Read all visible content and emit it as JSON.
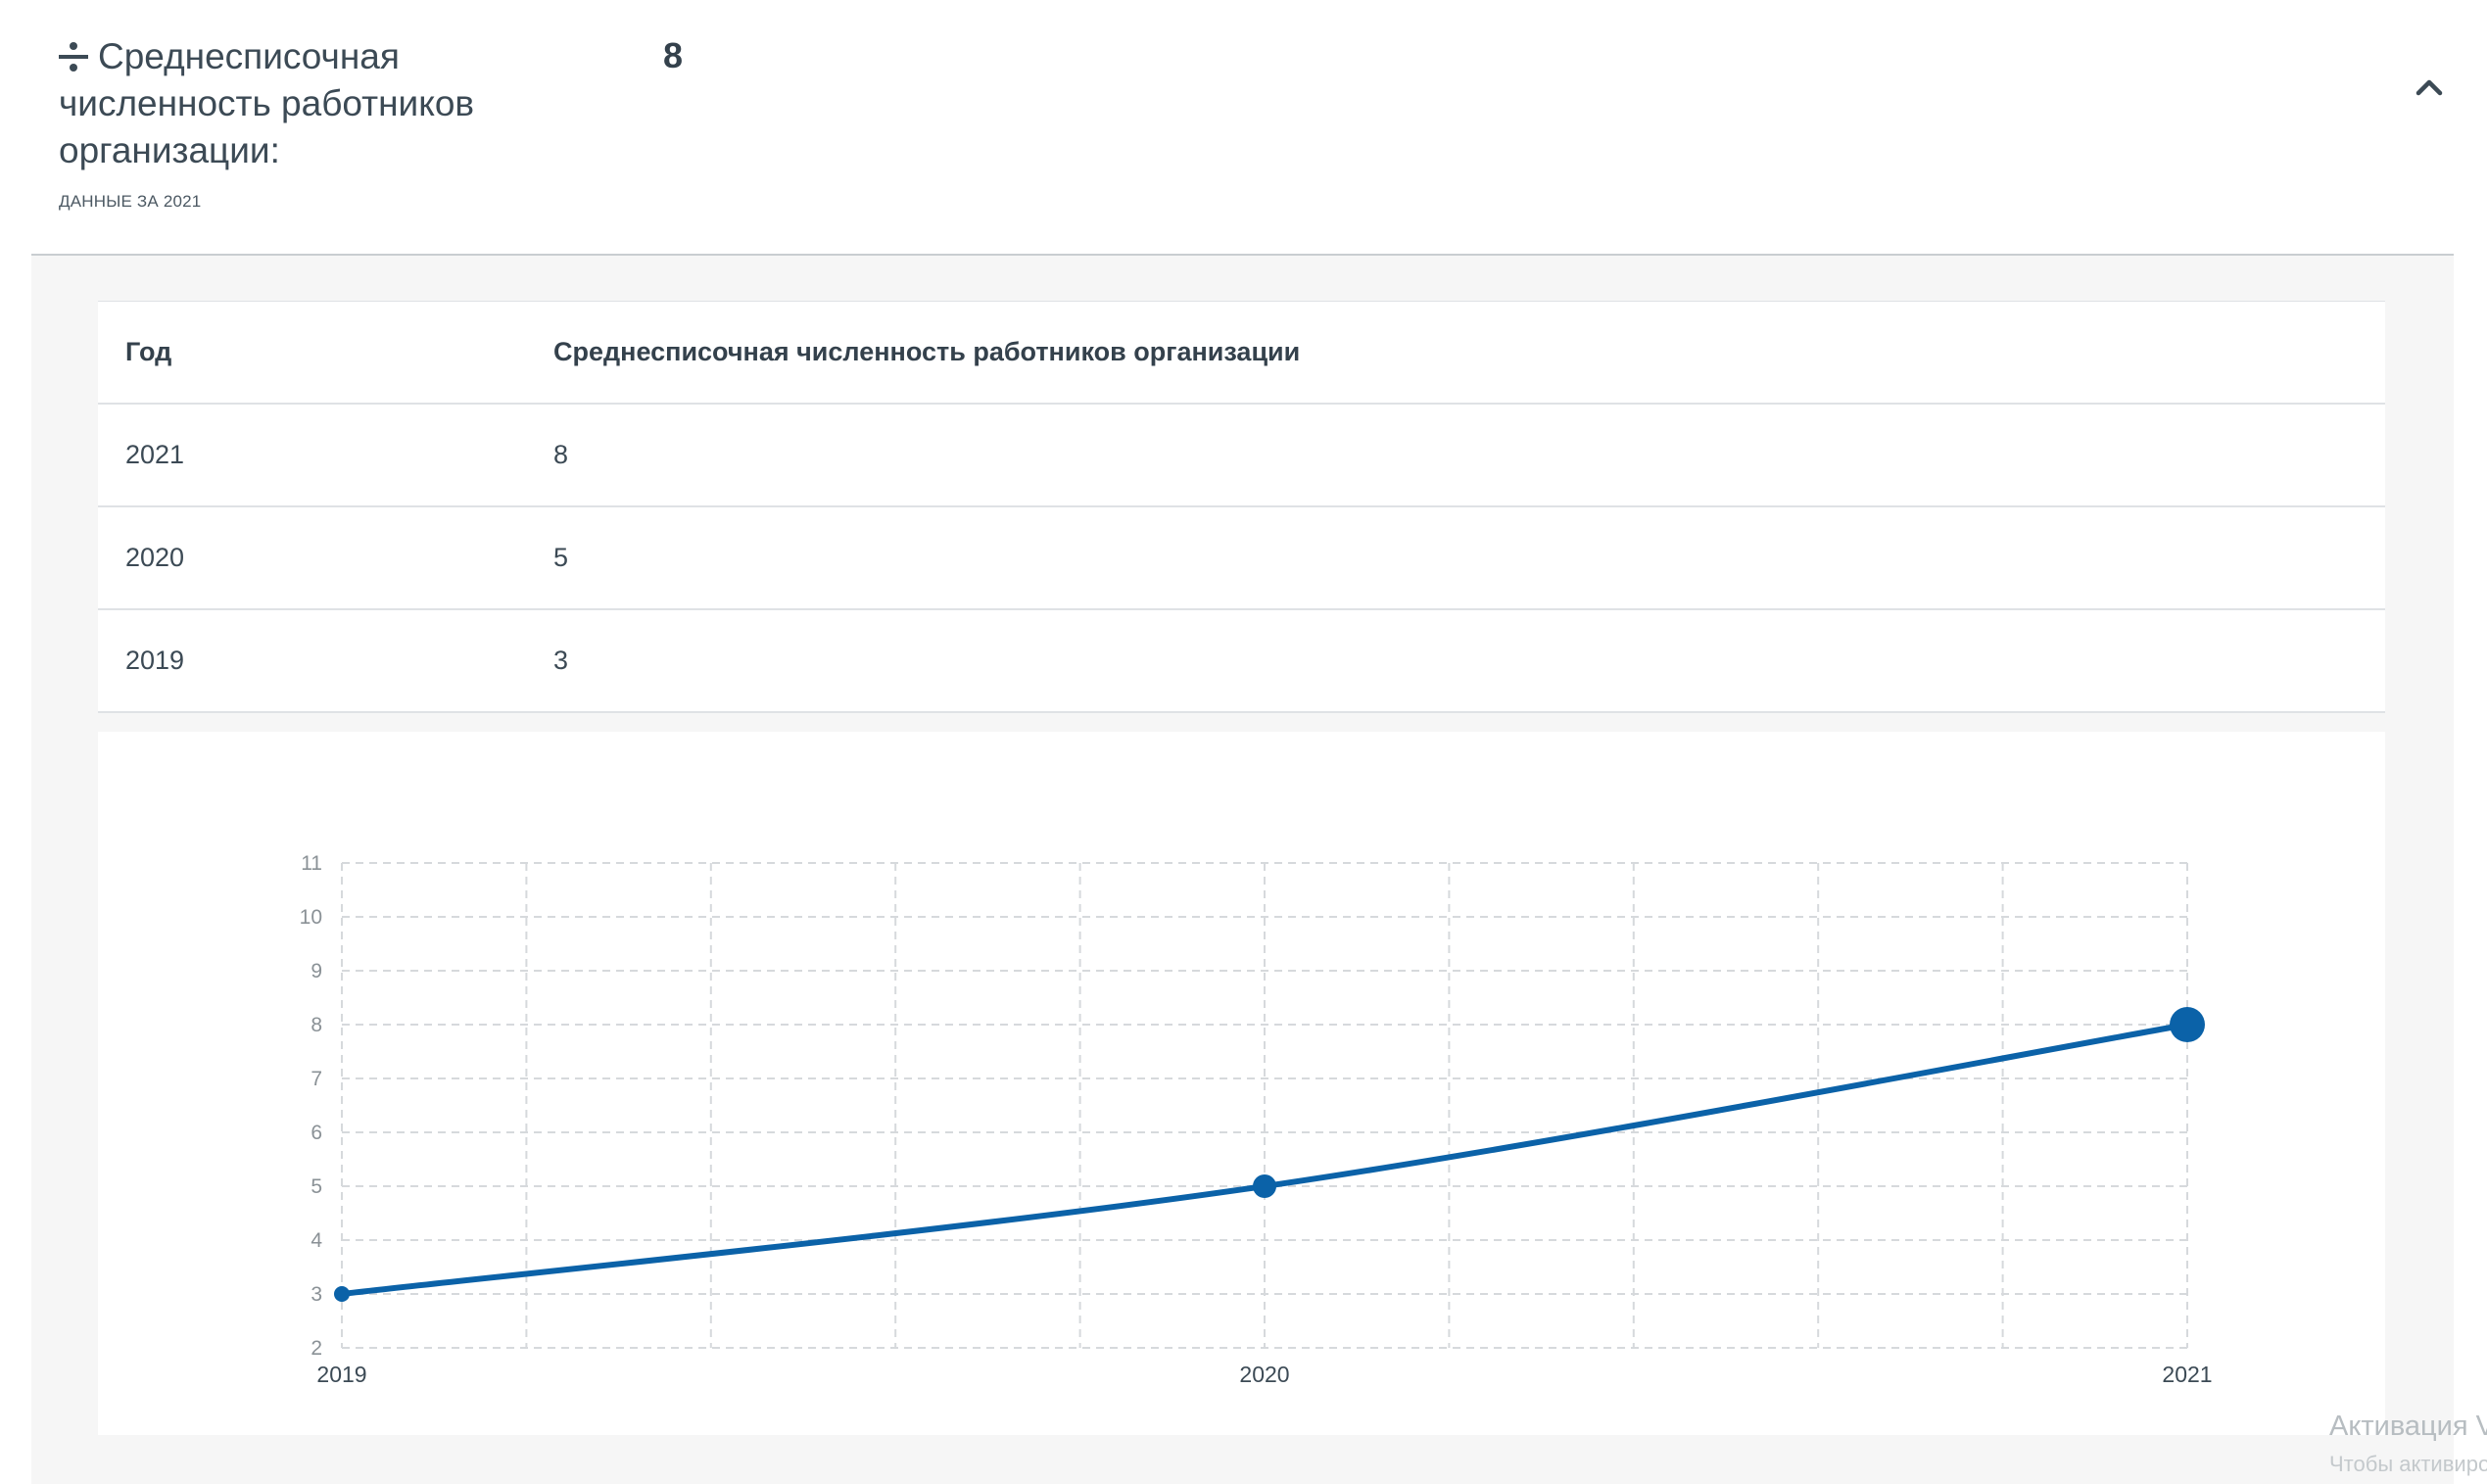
{
  "header": {
    "title": "Среднесписочная численность работников организации:",
    "subtitle": "ДАННЫЕ ЗА 2021",
    "value": "8"
  },
  "table": {
    "columns": [
      "Год",
      "Среднесписочная численность работников организации"
    ],
    "rows": [
      {
        "year": "2021",
        "value": "8"
      },
      {
        "year": "2020",
        "value": "5"
      },
      {
        "year": "2019",
        "value": "3"
      }
    ]
  },
  "chart_data": {
    "type": "line",
    "x": [
      "2019",
      "2020",
      "2021"
    ],
    "series": [
      {
        "values": [
          3,
          5,
          8
        ]
      }
    ],
    "ylim": [
      2,
      11
    ],
    "yticks": [
      2,
      3,
      4,
      5,
      6,
      7,
      8,
      9,
      10,
      11
    ],
    "grid": true,
    "color": "#0b62a8"
  },
  "watermark": {
    "line1": "Активация V",
    "line2": "Чтобы активиро"
  },
  "colors": {
    "accent": "#0b62a8",
    "text": "#3c4a55",
    "panel": "#f6f6f6"
  }
}
